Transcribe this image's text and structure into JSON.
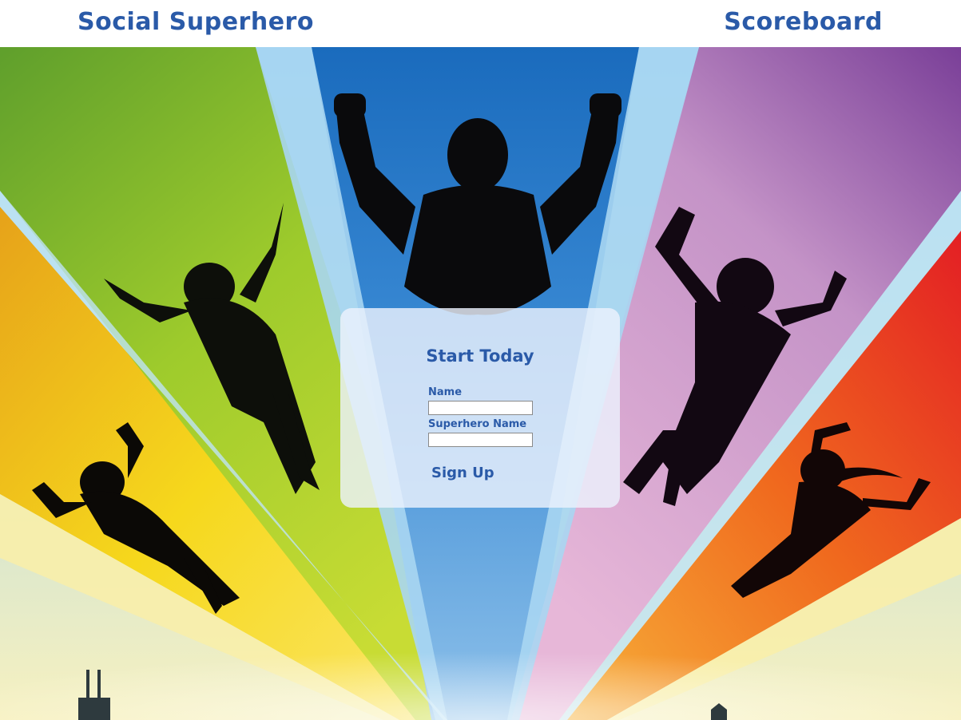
{
  "header": {
    "brand": "Social Superhero",
    "nav_link": "Scoreboard"
  },
  "signup": {
    "title": "Start Today",
    "name_label": "Name",
    "name_value": "",
    "superhero_name_label": "Superhero Name",
    "superhero_name_value": "",
    "button_label": "Sign Up"
  },
  "colors": {
    "brand_blue": "#2a5aa8",
    "ray_yellow": "#f5d21a",
    "ray_green": "#6fab2e",
    "ray_blue": "#1f6fc4",
    "ray_purple": "#8a4fa8",
    "ray_red": "#e8281e",
    "ray_light": "#a6d4f0"
  },
  "hero_image": {
    "description_icon": "superhero-silhouettes-illustration"
  }
}
